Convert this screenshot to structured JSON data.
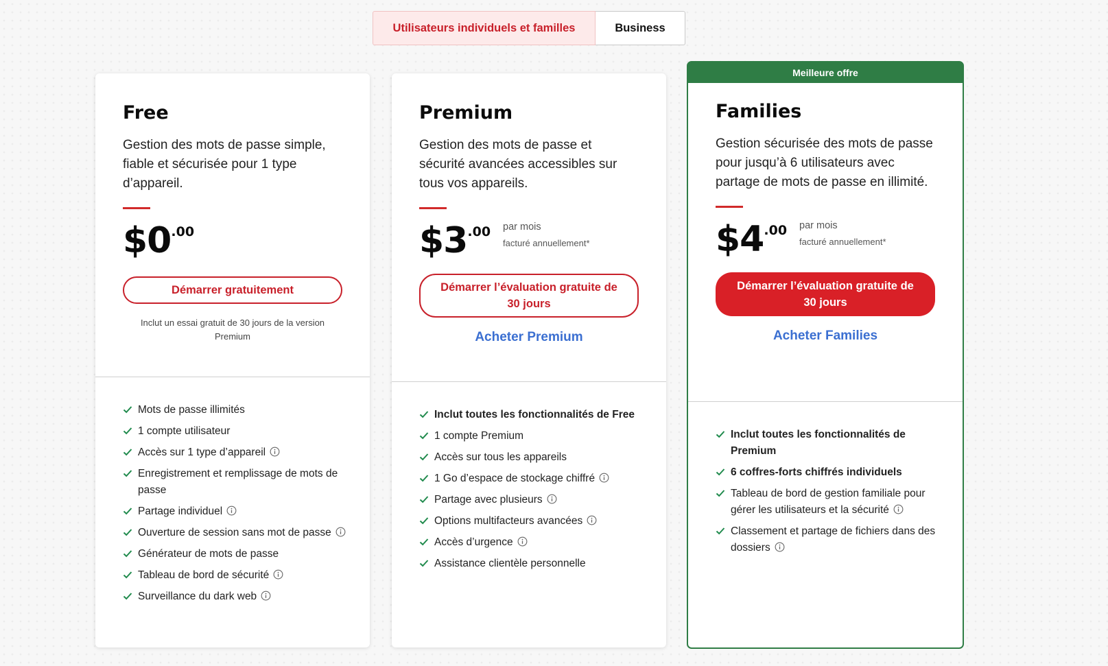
{
  "tabs": {
    "individuals": "Utilisateurs individuels et familles",
    "business": "Business"
  },
  "colors": {
    "accent_red": "#d92027",
    "featured_green": "#2f7d45",
    "link_blue": "#3b6fd1"
  },
  "plans": {
    "free": {
      "title": "Free",
      "description": "Gestion des mots de passe simple, fiable et sécurisée pour 1 type d’appareil.",
      "price_whole": "$0",
      "price_cents": ".00",
      "cta": "Démarrer gratuitement",
      "note": "Inclut un essai gratuit de 30 jours de la version Premium",
      "features": [
        {
          "text": "Mots de passe illimités",
          "info": false,
          "bold": false
        },
        {
          "text": "1 compte utilisateur",
          "info": false,
          "bold": false
        },
        {
          "text": "Accès sur 1 type d’appareil",
          "info": true,
          "bold": false
        },
        {
          "text": "Enregistrement et remplissage de mots de passe",
          "info": false,
          "bold": false
        },
        {
          "text": "Partage individuel",
          "info": true,
          "bold": false
        },
        {
          "text": "Ouverture de session sans mot de passe",
          "info": true,
          "bold": false
        },
        {
          "text": "Générateur de mots de passe",
          "info": false,
          "bold": false
        },
        {
          "text": "Tableau de bord de sécurité",
          "info": true,
          "bold": false
        },
        {
          "text": "Surveillance du dark web",
          "info": true,
          "bold": false
        }
      ]
    },
    "premium": {
      "title": "Premium",
      "description": "Gestion des mots de passe et sécurité avancées accessibles sur tous vos appareils.",
      "price_whole": "$3",
      "price_cents": ".00",
      "per": "par mois",
      "billed": "facturé annuellement*",
      "cta": "Démarrer l’évaluation gratuite de 30 jours",
      "buy": "Acheter Premium",
      "features": [
        {
          "text": "Inclut toutes les fonctionnalités de Free",
          "info": false,
          "bold": true
        },
        {
          "text": "1 compte Premium",
          "info": false,
          "bold": false
        },
        {
          "text": "Accès sur tous les appareils",
          "info": false,
          "bold": false
        },
        {
          "text": "1 Go d’espace de stockage chiffré",
          "info": true,
          "bold": false
        },
        {
          "text": "Partage avec plusieurs",
          "info": true,
          "bold": false
        },
        {
          "text": "Options multifacteurs avancées",
          "info": true,
          "bold": false
        },
        {
          "text": "Accès d’urgence",
          "info": true,
          "bold": false
        },
        {
          "text": "Assistance clientèle personnelle",
          "info": false,
          "bold": false
        }
      ]
    },
    "families": {
      "badge": "Meilleure offre",
      "title": "Families",
      "description": "Gestion sécurisée des mots de passe pour jusqu’à 6 utilisateurs avec partage de mots de passe en illimité.",
      "price_whole": "$4",
      "price_cents": ".00",
      "per": "par mois",
      "billed": "facturé annuellement*",
      "cta": "Démarrer l’évaluation gratuite de 30 jours",
      "buy": "Acheter Families",
      "features": [
        {
          "text": "Inclut toutes les fonctionnalités de Premium",
          "info": false,
          "bold": true
        },
        {
          "text": "6 coffres-forts chiffrés individuels",
          "info": false,
          "bold": true
        },
        {
          "text": "Tableau de bord de gestion familiale pour gérer les utilisateurs et la sécurité",
          "info": true,
          "bold": false
        },
        {
          "text": "Classement et partage de fichiers dans des dossiers",
          "info": true,
          "bold": false
        }
      ]
    }
  }
}
